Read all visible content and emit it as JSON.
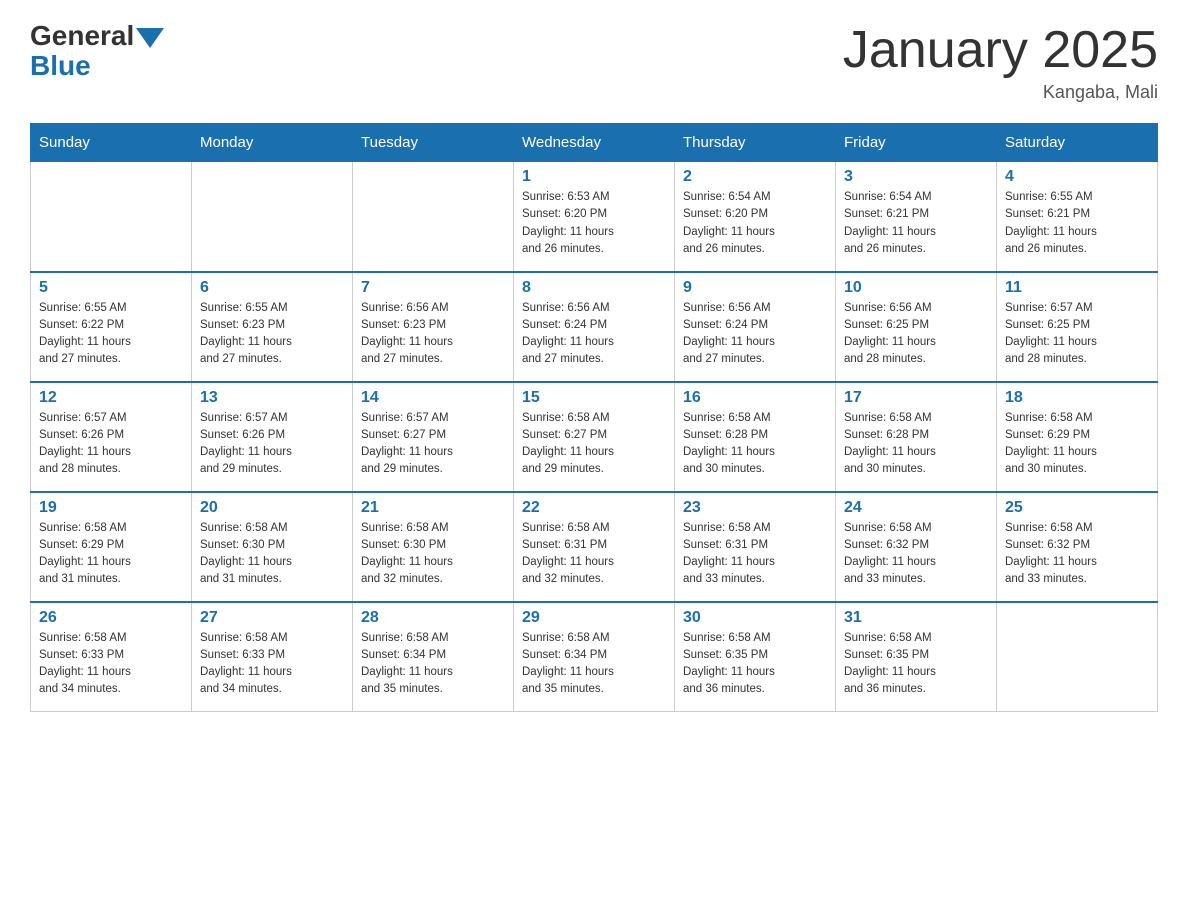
{
  "header": {
    "logo_general": "General",
    "logo_blue": "Blue",
    "title": "January 2025",
    "subtitle": "Kangaba, Mali"
  },
  "days_of_week": [
    "Sunday",
    "Monday",
    "Tuesday",
    "Wednesday",
    "Thursday",
    "Friday",
    "Saturday"
  ],
  "weeks": [
    [
      {
        "day": "",
        "info": ""
      },
      {
        "day": "",
        "info": ""
      },
      {
        "day": "",
        "info": ""
      },
      {
        "day": "1",
        "info": "Sunrise: 6:53 AM\nSunset: 6:20 PM\nDaylight: 11 hours\nand 26 minutes."
      },
      {
        "day": "2",
        "info": "Sunrise: 6:54 AM\nSunset: 6:20 PM\nDaylight: 11 hours\nand 26 minutes."
      },
      {
        "day": "3",
        "info": "Sunrise: 6:54 AM\nSunset: 6:21 PM\nDaylight: 11 hours\nand 26 minutes."
      },
      {
        "day": "4",
        "info": "Sunrise: 6:55 AM\nSunset: 6:21 PM\nDaylight: 11 hours\nand 26 minutes."
      }
    ],
    [
      {
        "day": "5",
        "info": "Sunrise: 6:55 AM\nSunset: 6:22 PM\nDaylight: 11 hours\nand 27 minutes."
      },
      {
        "day": "6",
        "info": "Sunrise: 6:55 AM\nSunset: 6:23 PM\nDaylight: 11 hours\nand 27 minutes."
      },
      {
        "day": "7",
        "info": "Sunrise: 6:56 AM\nSunset: 6:23 PM\nDaylight: 11 hours\nand 27 minutes."
      },
      {
        "day": "8",
        "info": "Sunrise: 6:56 AM\nSunset: 6:24 PM\nDaylight: 11 hours\nand 27 minutes."
      },
      {
        "day": "9",
        "info": "Sunrise: 6:56 AM\nSunset: 6:24 PM\nDaylight: 11 hours\nand 27 minutes."
      },
      {
        "day": "10",
        "info": "Sunrise: 6:56 AM\nSunset: 6:25 PM\nDaylight: 11 hours\nand 28 minutes."
      },
      {
        "day": "11",
        "info": "Sunrise: 6:57 AM\nSunset: 6:25 PM\nDaylight: 11 hours\nand 28 minutes."
      }
    ],
    [
      {
        "day": "12",
        "info": "Sunrise: 6:57 AM\nSunset: 6:26 PM\nDaylight: 11 hours\nand 28 minutes."
      },
      {
        "day": "13",
        "info": "Sunrise: 6:57 AM\nSunset: 6:26 PM\nDaylight: 11 hours\nand 29 minutes."
      },
      {
        "day": "14",
        "info": "Sunrise: 6:57 AM\nSunset: 6:27 PM\nDaylight: 11 hours\nand 29 minutes."
      },
      {
        "day": "15",
        "info": "Sunrise: 6:58 AM\nSunset: 6:27 PM\nDaylight: 11 hours\nand 29 minutes."
      },
      {
        "day": "16",
        "info": "Sunrise: 6:58 AM\nSunset: 6:28 PM\nDaylight: 11 hours\nand 30 minutes."
      },
      {
        "day": "17",
        "info": "Sunrise: 6:58 AM\nSunset: 6:28 PM\nDaylight: 11 hours\nand 30 minutes."
      },
      {
        "day": "18",
        "info": "Sunrise: 6:58 AM\nSunset: 6:29 PM\nDaylight: 11 hours\nand 30 minutes."
      }
    ],
    [
      {
        "day": "19",
        "info": "Sunrise: 6:58 AM\nSunset: 6:29 PM\nDaylight: 11 hours\nand 31 minutes."
      },
      {
        "day": "20",
        "info": "Sunrise: 6:58 AM\nSunset: 6:30 PM\nDaylight: 11 hours\nand 31 minutes."
      },
      {
        "day": "21",
        "info": "Sunrise: 6:58 AM\nSunset: 6:30 PM\nDaylight: 11 hours\nand 32 minutes."
      },
      {
        "day": "22",
        "info": "Sunrise: 6:58 AM\nSunset: 6:31 PM\nDaylight: 11 hours\nand 32 minutes."
      },
      {
        "day": "23",
        "info": "Sunrise: 6:58 AM\nSunset: 6:31 PM\nDaylight: 11 hours\nand 33 minutes."
      },
      {
        "day": "24",
        "info": "Sunrise: 6:58 AM\nSunset: 6:32 PM\nDaylight: 11 hours\nand 33 minutes."
      },
      {
        "day": "25",
        "info": "Sunrise: 6:58 AM\nSunset: 6:32 PM\nDaylight: 11 hours\nand 33 minutes."
      }
    ],
    [
      {
        "day": "26",
        "info": "Sunrise: 6:58 AM\nSunset: 6:33 PM\nDaylight: 11 hours\nand 34 minutes."
      },
      {
        "day": "27",
        "info": "Sunrise: 6:58 AM\nSunset: 6:33 PM\nDaylight: 11 hours\nand 34 minutes."
      },
      {
        "day": "28",
        "info": "Sunrise: 6:58 AM\nSunset: 6:34 PM\nDaylight: 11 hours\nand 35 minutes."
      },
      {
        "day": "29",
        "info": "Sunrise: 6:58 AM\nSunset: 6:34 PM\nDaylight: 11 hours\nand 35 minutes."
      },
      {
        "day": "30",
        "info": "Sunrise: 6:58 AM\nSunset: 6:35 PM\nDaylight: 11 hours\nand 36 minutes."
      },
      {
        "day": "31",
        "info": "Sunrise: 6:58 AM\nSunset: 6:35 PM\nDaylight: 11 hours\nand 36 minutes."
      },
      {
        "day": "",
        "info": ""
      }
    ]
  ]
}
